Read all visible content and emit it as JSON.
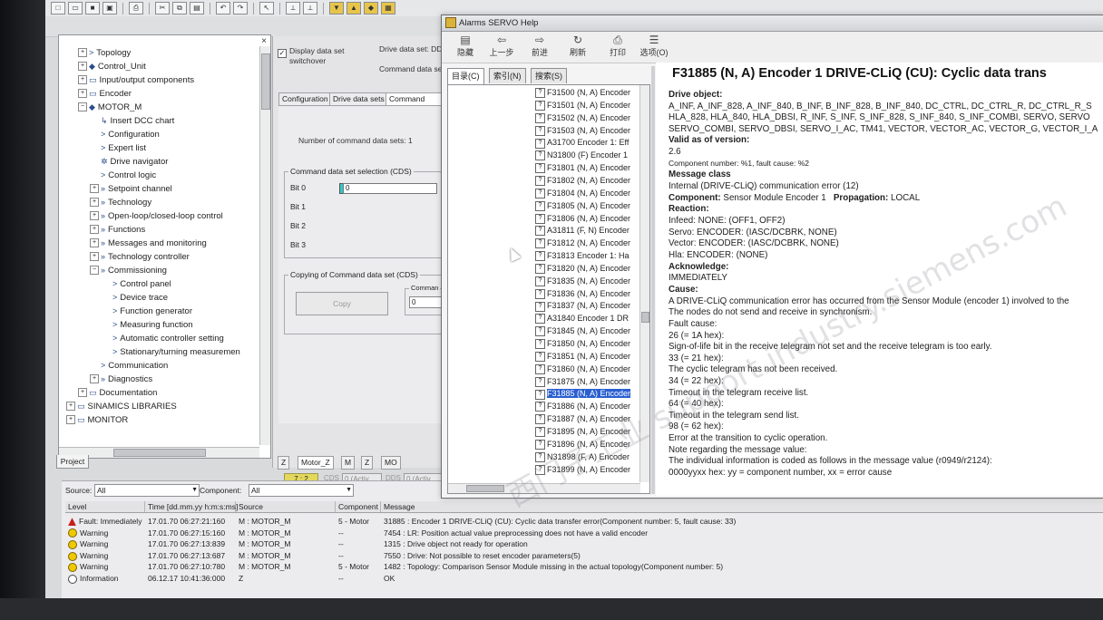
{
  "tree": {
    "items": [
      {
        "label": "Topology",
        "indent": 1,
        "pm": "+",
        "icon": ">"
      },
      {
        "label": "Control_Unit",
        "indent": 1,
        "pm": "+",
        "icon": "◆"
      },
      {
        "label": "Input/output components",
        "indent": 1,
        "pm": "+",
        "icon": "▭"
      },
      {
        "label": "Encoder",
        "indent": 1,
        "pm": "+",
        "icon": "▭"
      },
      {
        "label": "MOTOR_M",
        "indent": 1,
        "pm": "−",
        "icon": "◆"
      },
      {
        "label": "Insert DCC chart",
        "indent": 2,
        "pm": "",
        "icon": "↳"
      },
      {
        "label": "Configuration",
        "indent": 2,
        "pm": "",
        "icon": ">"
      },
      {
        "label": "Expert list",
        "indent": 2,
        "pm": "",
        "icon": ">"
      },
      {
        "label": "Drive navigator",
        "indent": 2,
        "pm": "",
        "icon": "✲"
      },
      {
        "label": "Control logic",
        "indent": 2,
        "pm": "",
        "icon": ">"
      },
      {
        "label": "Setpoint channel",
        "indent": 2,
        "pm": "+",
        "icon": "»"
      },
      {
        "label": "Technology",
        "indent": 2,
        "pm": "+",
        "icon": "»"
      },
      {
        "label": "Open-loop/closed-loop control",
        "indent": 2,
        "pm": "+",
        "icon": "»"
      },
      {
        "label": "Functions",
        "indent": 2,
        "pm": "+",
        "icon": "»"
      },
      {
        "label": "Messages and monitoring",
        "indent": 2,
        "pm": "+",
        "icon": "»"
      },
      {
        "label": "Technology controller",
        "indent": 2,
        "pm": "+",
        "icon": "»"
      },
      {
        "label": "Commissioning",
        "indent": 2,
        "pm": "−",
        "icon": "»"
      },
      {
        "label": "Control panel",
        "indent": 3,
        "pm": "",
        "icon": ">"
      },
      {
        "label": "Device trace",
        "indent": 3,
        "pm": "",
        "icon": ">"
      },
      {
        "label": "Function generator",
        "indent": 3,
        "pm": "",
        "icon": ">"
      },
      {
        "label": "Measuring function",
        "indent": 3,
        "pm": "",
        "icon": ">"
      },
      {
        "label": "Automatic controller setting",
        "indent": 3,
        "pm": "",
        "icon": ">"
      },
      {
        "label": "Stationary/turning measuremen",
        "indent": 3,
        "pm": "",
        "icon": ">"
      },
      {
        "label": "Communication",
        "indent": 2,
        "pm": "",
        "icon": ">"
      },
      {
        "label": "Diagnostics",
        "indent": 2,
        "pm": "+",
        "icon": "»"
      },
      {
        "label": "Documentation",
        "indent": 1,
        "pm": "+",
        "icon": "▭"
      },
      {
        "label": "SINAMICS LIBRARIES",
        "indent": 0,
        "pm": "+",
        "icon": "▭"
      },
      {
        "label": "MONITOR",
        "indent": 0,
        "pm": "+",
        "icon": "▭"
      }
    ],
    "project_tab": "Project"
  },
  "cds": {
    "checkbox_label1": "Display data set",
    "checkbox_label2": "switchover",
    "drive_ds_label": "Drive data set: DD",
    "cmd_ds_label": "Command data set",
    "tabs": [
      "Configuration",
      "Drive data sets",
      "Command data"
    ],
    "num_cmd_sets": "Number of command data sets: 1",
    "selection_group": "Command data set selection (CDS)",
    "bits": [
      "Bit 0",
      "Bit 1",
      "Bit 2",
      "Bit 3"
    ],
    "bit0_value": "0",
    "copying_group": "Copying of Command data set (CDS)",
    "copy_button": "Copy",
    "command_group": "Comman",
    "command_value": "0",
    "status_value": "7 : 2",
    "cds_label": "CDS",
    "cds_value": "0 (Activ",
    "dds_label": "DDS",
    "dds_value": "0 (Activ",
    "bottom_tabs": [
      "Z",
      "Motor_Z",
      "M",
      "Z",
      "MO"
    ]
  },
  "help": {
    "title": "Alarms SERVO Help",
    "toolbar": [
      "隐藏",
      "上一步",
      "前进",
      "刷新",
      "打印",
      "选项(O)"
    ],
    "toolbar_icons": [
      "▤",
      "⇦",
      "⇨",
      "↻",
      "⎙",
      "☰"
    ],
    "tabs": [
      "目录(C)",
      "索引(N)",
      "搜索(S)"
    ],
    "topics": [
      "F31500 (N, A) Encoder",
      "F31501 (N, A) Encoder",
      "F31502 (N, A) Encoder",
      "F31503 (N, A) Encoder",
      "A31700 Encoder 1: Eff",
      "N31800 (F) Encoder 1",
      "F31801 (N, A) Encoder",
      "F31802 (N, A) Encoder",
      "F31804 (N, A) Encoder",
      "F31805 (N, A) Encoder",
      "F31806 (N, A) Encoder",
      "A31811 (F, N) Encoder",
      "F31812 (N, A) Encoder",
      "F31813 Encoder 1: Ha",
      "F31820 (N, A) Encoder",
      "F31835 (N, A) Encoder",
      "F31836 (N, A) Encoder",
      "F31837 (N, A) Encoder",
      "A31840 Encoder 1 DR",
      "F31845 (N, A) Encoder",
      "F31850 (N, A) Encoder",
      "F31851 (N, A) Encoder",
      "F31860 (N, A) Encoder",
      "F31875 (N, A) Encoder",
      "F31885 (N, A) Encoder",
      "F31886 (N, A) Encoder",
      "F31887 (N, A) Encoder",
      "F31895 (N, A) Encoder",
      "F31896 (N, A) Encoder",
      "N31898 (F, A) Encoder",
      "F31899 (N, A) Encoder"
    ],
    "selected_index": 24,
    "heading": "F31885 (N, A) Encoder 1 DRIVE-CLiQ (CU): Cyclic data trans",
    "content": [
      {
        "t": "Drive object:",
        "s": "b"
      },
      {
        "t": "A_INF, A_INF_828, A_INF_840, B_INF, B_INF_828, B_INF_840, DC_CTRL, DC_CTRL_R, DC_CTRL_R_S",
        "s": ""
      },
      {
        "t": "HLA_828, HLA_840, HLA_DBSI, R_INF, S_INF, S_INF_828, S_INF_840, S_INF_COMBI, SERVO, SERVO",
        "s": ""
      },
      {
        "t": "SERVO_COMBI, SERVO_DBSI, SERVO_I_AC, TM41, VECTOR, VECTOR_AC, VECTOR_G, VECTOR_I_A",
        "s": ""
      },
      {
        "t": "Valid as of version:",
        "s": "b"
      },
      {
        "t": "2.6",
        "s": ""
      },
      {
        "t": "Component number: %1, fault cause: %2",
        "s": "sm"
      },
      {
        "t": "Message class",
        "s": "b"
      },
      {
        "t": "Internal (DRIVE-CLiQ) communication error (12)",
        "s": ""
      },
      {
        "t": "COMPONENT_ROW",
        "s": ""
      },
      {
        "t": "Reaction:",
        "s": "b"
      },
      {
        "t": "Infeed: NONE: (OFF1, OFF2)",
        "s": ""
      },
      {
        "t": "Servo: ENCODER: (IASC/DCBRK, NONE)",
        "s": ""
      },
      {
        "t": "Vector: ENCODER: (IASC/DCBRK, NONE)",
        "s": ""
      },
      {
        "t": "Hla: ENCODER: (NONE)",
        "s": ""
      },
      {
        "t": "Acknowledge:",
        "s": "b"
      },
      {
        "t": "IMMEDIATELY",
        "s": ""
      },
      {
        "t": "Cause:",
        "s": "b"
      },
      {
        "t": "A DRIVE-CLiQ communication error has occurred from the Sensor Module (encoder 1) involved to the",
        "s": ""
      },
      {
        "t": "The nodes do not send and receive in synchronism.",
        "s": ""
      },
      {
        "t": "Fault cause:",
        "s": ""
      },
      {
        "t": "26 (= 1A hex):",
        "s": ""
      },
      {
        "t": "Sign-of-life bit in the receive telegram not set and the receive telegram is too early.",
        "s": ""
      },
      {
        "t": "33 (= 21 hex):",
        "s": ""
      },
      {
        "t": "The cyclic telegram has not been received.",
        "s": ""
      },
      {
        "t": "34 (= 22 hex):",
        "s": ""
      },
      {
        "t": "Timeout in the telegram receive list.",
        "s": ""
      },
      {
        "t": "64 (= 40 hex):",
        "s": ""
      },
      {
        "t": "Timeout in the telegram send list.",
        "s": ""
      },
      {
        "t": "98 (= 62 hex):",
        "s": ""
      },
      {
        "t": "Error at the transition to cyclic operation.",
        "s": ""
      },
      {
        "t": "Note regarding the message value:",
        "s": ""
      },
      {
        "t": "The individual information is coded as follows in the message value (r0949/r2124):",
        "s": ""
      },
      {
        "t": "0000yyxx hex: yy = component number, xx = error cause",
        "s": ""
      }
    ],
    "component_label": "Component:",
    "component_value": "Sensor Module Encoder 1",
    "propagation_label": "Propagation:",
    "propagation_value": "LOCAL"
  },
  "alarms": {
    "source_label": "Source:",
    "source_value": "All",
    "component_label": "Component:",
    "component_value": "All",
    "columns": [
      "Level",
      "Time [dd.mm.yy  h:m:s:ms]",
      "Source",
      "Component",
      "Message"
    ],
    "rows": [
      {
        "level": "Fault: Immediately",
        "sev": "fault",
        "time": "17.01.70    06:27:21:160",
        "source": "M : MOTOR_M",
        "component": "5 - Motor",
        "message": "31885 : Encoder 1 DRIVE-CLiQ (CU): Cyclic data transfer error(Component number: 5, fault cause: 33)"
      },
      {
        "level": "Warning",
        "sev": "warn",
        "time": "17.01.70    06:27:15:160",
        "source": "M : MOTOR_M",
        "component": "--",
        "message": "7454 : LR: Position actual value preprocessing does not have a valid encoder"
      },
      {
        "level": "Warning",
        "sev": "warn",
        "time": "17.01.70    06:27:13:839",
        "source": "M : MOTOR_M",
        "component": "--",
        "message": "1315 : Drive object not ready for operation"
      },
      {
        "level": "Warning",
        "sev": "warn",
        "time": "17.01.70    06:27:13:687",
        "source": "M : MOTOR_M",
        "component": "--",
        "message": "7550 : Drive: Not possible to reset encoder parameters(5)"
      },
      {
        "level": "Warning",
        "sev": "warn",
        "time": "17.01.70    06:27:10:780",
        "source": "M : MOTOR_M",
        "component": "5 - Motor",
        "message": "1482 : Topology: Comparison Sensor Module missing in the actual topology(Component number: 5)"
      },
      {
        "level": "Information",
        "sev": "info",
        "time": "06.12.17    10:41:36:000",
        "source": "Z",
        "component": "--",
        "message": "OK"
      }
    ]
  },
  "watermark": "西门子工业  support.industry.siemens.com"
}
